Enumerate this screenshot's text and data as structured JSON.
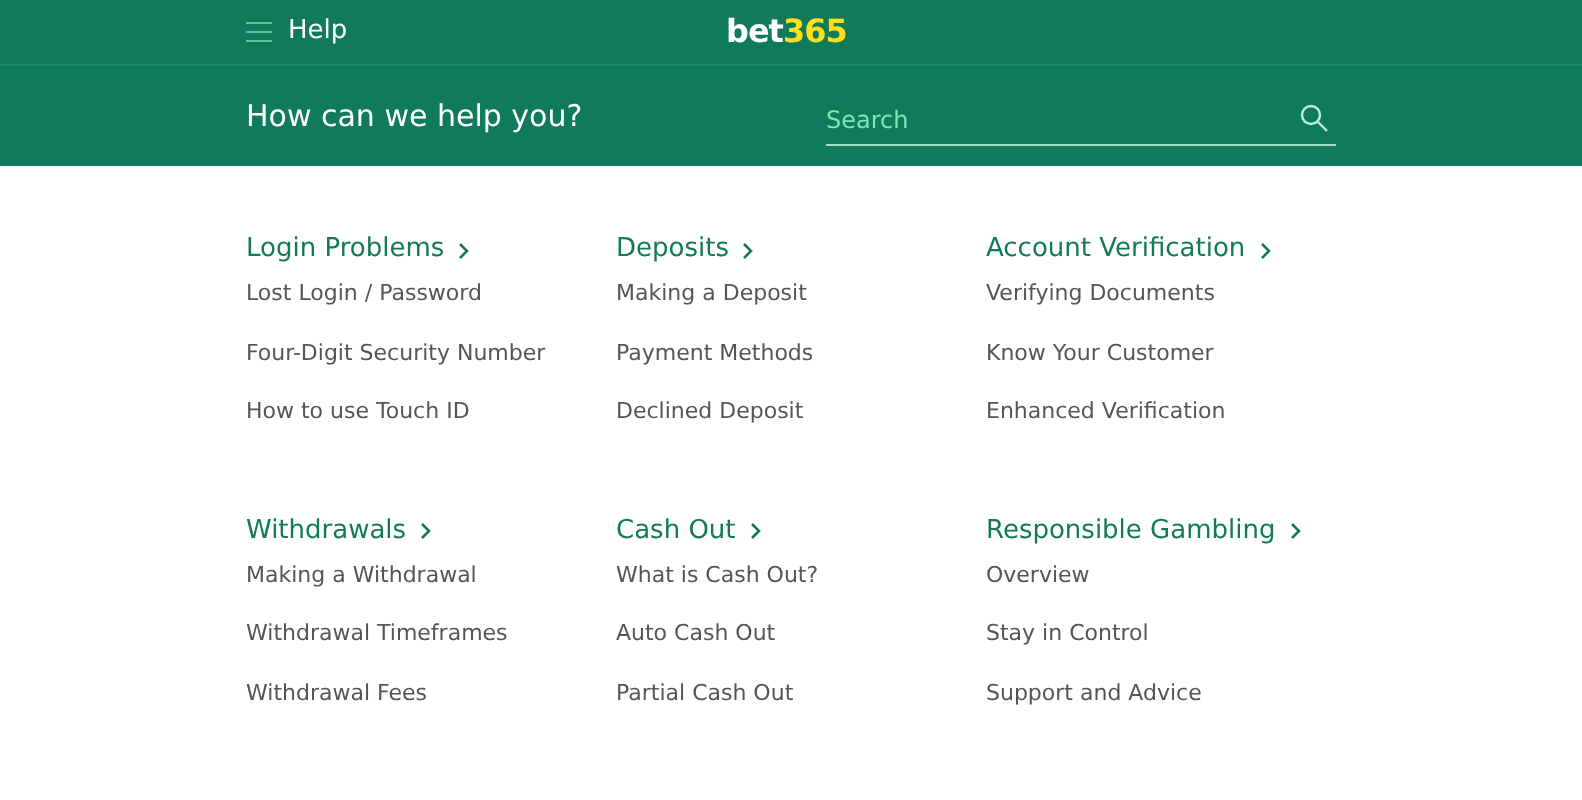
{
  "topbar": {
    "menu_label": "Help",
    "logo": {
      "part_1": "bet",
      "part_2": "365"
    }
  },
  "search_bar": {
    "title": "How can we help you?",
    "placeholder": "Search"
  },
  "sections": [
    {
      "heading": "Login Problems",
      "links": [
        "Lost Login / Password",
        "Four-Digit Security Number",
        "How to use Touch ID"
      ]
    },
    {
      "heading": "Deposits",
      "links": [
        "Making a Deposit",
        "Payment Methods",
        "Declined Deposit"
      ]
    },
    {
      "heading": "Account Verification",
      "links": [
        "Verifying Documents",
        "Know Your Customer",
        "Enhanced Verification"
      ]
    },
    {
      "heading": "Withdrawals",
      "links": [
        "Making a Withdrawal",
        "Withdrawal Timeframes",
        "Withdrawal Fees"
      ]
    },
    {
      "heading": "Cash Out",
      "links": [
        "What is Cash Out?",
        "Auto Cash Out",
        "Partial Cash Out"
      ]
    },
    {
      "heading": "Responsible Gambling",
      "links": [
        "Overview",
        "Stay in Control",
        "Support and Advice"
      ]
    }
  ]
}
